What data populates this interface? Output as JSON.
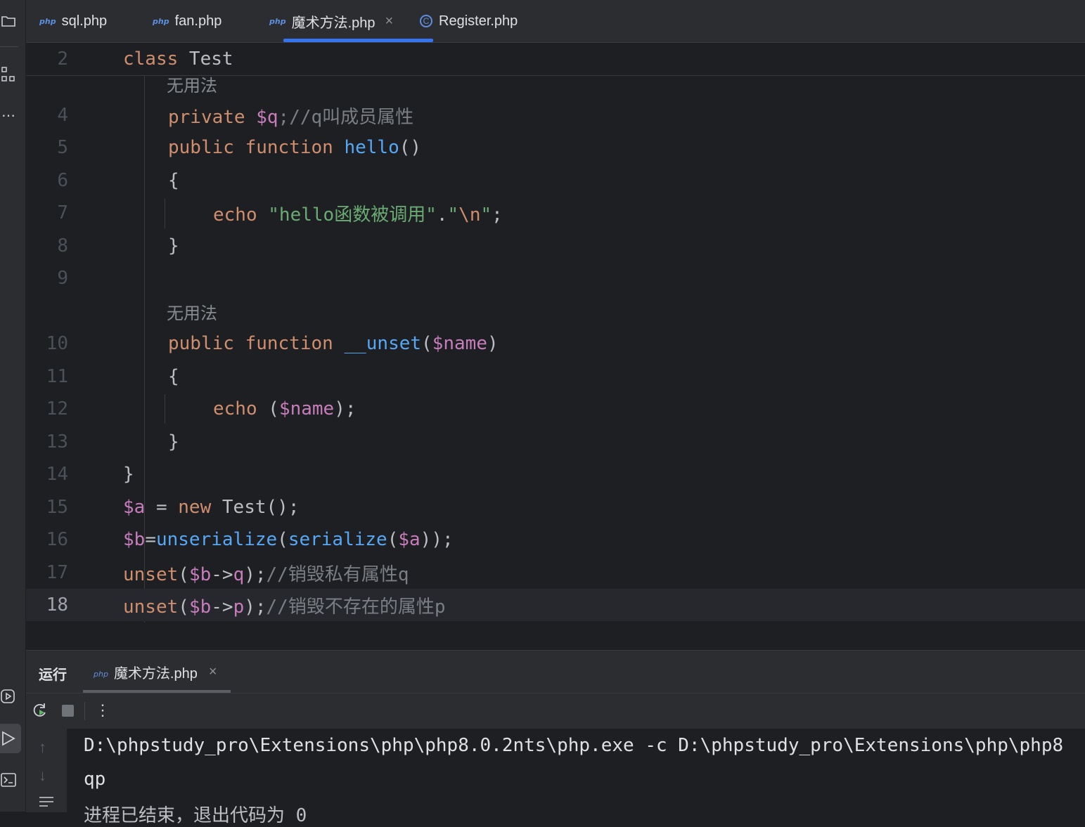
{
  "tabs": [
    {
      "label": "sql.php",
      "badge": "php",
      "active": false
    },
    {
      "label": "fan.php",
      "badge": "php",
      "active": false
    },
    {
      "label": "魔术方法.php",
      "badge": "php",
      "active": true,
      "close": "×"
    },
    {
      "label": "Register.php",
      "badge": "C",
      "active": false
    }
  ],
  "editor": {
    "sticky": {
      "line_number": "2",
      "text": "class Test"
    },
    "hint_label": "无用法",
    "lines": [
      {
        "n": "4",
        "tokens": [
          "private",
          " $q",
          ";//q叫成员属性"
        ]
      },
      {
        "n": "5",
        "tokens": [
          "public function",
          " hello",
          "()"
        ]
      },
      {
        "n": "6",
        "tokens": [
          "{"
        ]
      },
      {
        "n": "7",
        "tokens": [
          "echo",
          " \"hello函数被调用\"",
          ".",
          "\"",
          "\\n",
          "\"",
          ";"
        ]
      },
      {
        "n": "8",
        "tokens": [
          "}"
        ]
      },
      {
        "n": "9",
        "tokens": []
      },
      {
        "n": "10",
        "tokens": [
          "public function",
          " __unset",
          "(",
          "$name",
          ")"
        ]
      },
      {
        "n": "11",
        "tokens": [
          "{"
        ]
      },
      {
        "n": "12",
        "tokens": [
          "echo",
          " (",
          "$name",
          ");"
        ]
      },
      {
        "n": "13",
        "tokens": [
          "}"
        ]
      },
      {
        "n": "14",
        "tokens": [
          "}"
        ]
      },
      {
        "n": "15",
        "tokens": [
          "$a",
          " = ",
          "new",
          " Test();"
        ]
      },
      {
        "n": "16",
        "tokens": [
          "$b",
          "=",
          "unserialize",
          "(",
          "serialize",
          "(",
          "$a",
          "));"
        ]
      },
      {
        "n": "17",
        "tokens": [
          "unset",
          "(",
          "$b",
          "->",
          "q",
          ");",
          "//销毁私有属性q"
        ]
      },
      {
        "n": "18",
        "tokens": [
          "unset",
          "(",
          "$b",
          "->",
          "p",
          ");",
          "//销毁不存在的属性p"
        ]
      }
    ],
    "current_line": "18"
  },
  "run_panel": {
    "title": "运行",
    "tab_label": "魔术方法.php",
    "tab_badge": "php",
    "tab_close": "×",
    "console": [
      "D:\\phpstudy_pro\\Extensions\\php\\php8.0.2nts\\php.exe -c D:\\phpstudy_pro\\Extensions\\php\\php8",
      "qp",
      "进程已结束，退出代码为 0"
    ]
  },
  "colors": {
    "keyword": "#cf8e6d",
    "function": "#56a8f5",
    "variable": "#c77dbb",
    "string": "#6aab73",
    "comment": "#7a7e85",
    "accent": "#3574f0"
  }
}
